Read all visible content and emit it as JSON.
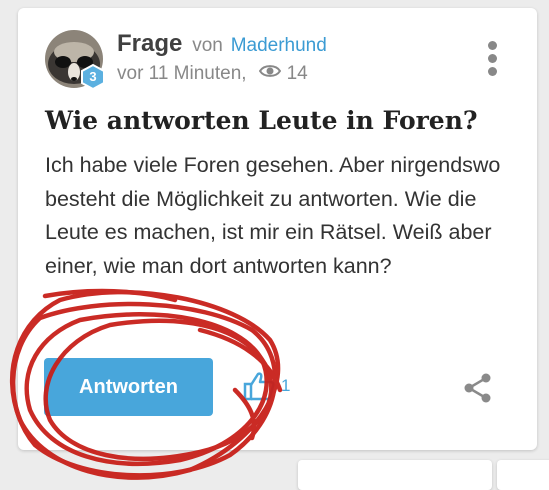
{
  "post": {
    "type_label": "Frage",
    "by_label": "von",
    "author": "Maderhund",
    "avatar_badge": "3",
    "time": "vor 11 Minuten,",
    "views": "14",
    "title": "Wie antworten Leute in Foren?",
    "body": "Ich habe viele Foren gesehen. Aber nirgendswo besteht die Möglichkeit zu antworten. Wie die Leute es machen, ist mir ein Rätsel. Weiß aber einer, wie man dort antworten kann?"
  },
  "actions": {
    "answer_label": "Antworten",
    "like_count": "1"
  },
  "icons": [
    "more-vertical-icon",
    "eye-icon",
    "thumbs-up-icon",
    "share-icon",
    "badge-hexagon-icon"
  ],
  "colors": {
    "accent": "#48a6db",
    "link": "#3b9bd3",
    "annotation_red": "#c8201a",
    "muted": "#888888"
  }
}
